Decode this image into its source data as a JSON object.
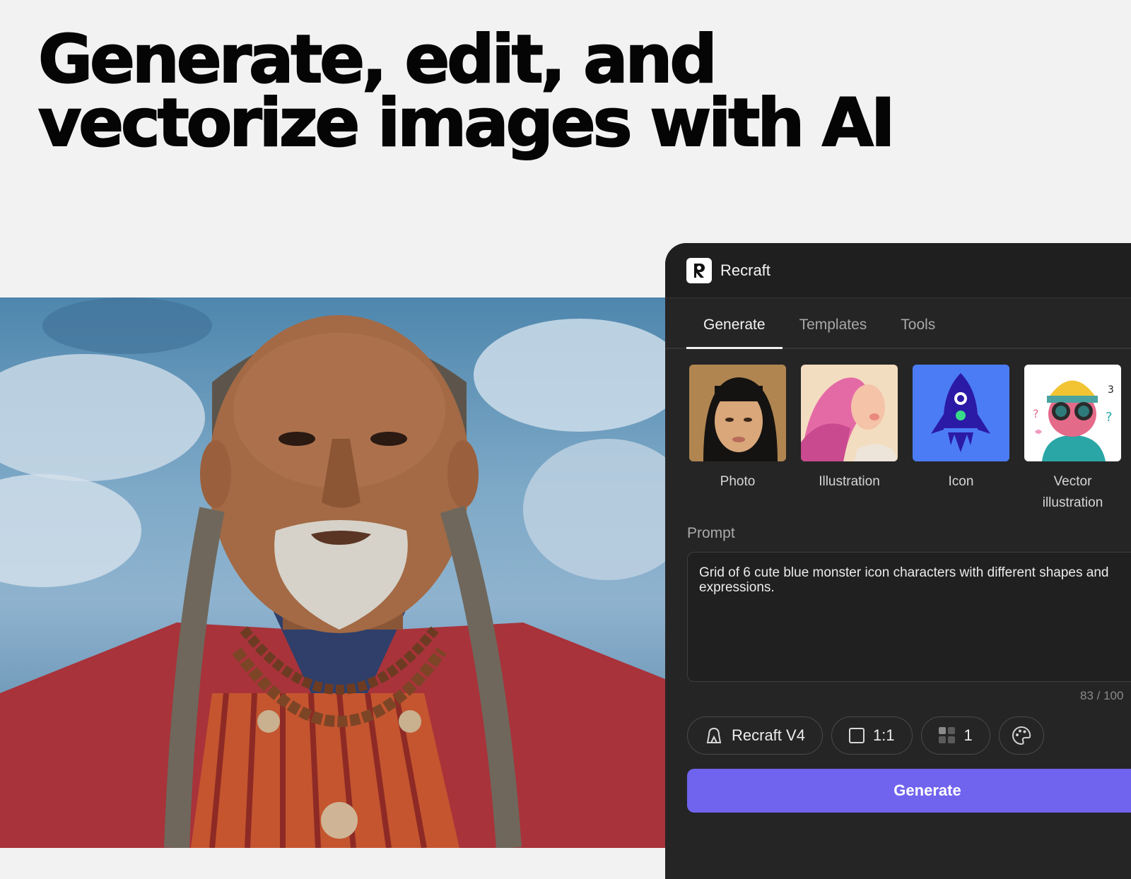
{
  "hero": {
    "line1": "Generate, edit, and",
    "line2": "vectorize images with AI"
  },
  "panel": {
    "app_title": "Recraft",
    "logo_icon": "recraft-logo-icon",
    "tabs": [
      {
        "label": "Generate",
        "active": true
      },
      {
        "label": "Templates",
        "active": false
      },
      {
        "label": "Tools",
        "active": false
      }
    ],
    "styles": [
      {
        "label": "Photo"
      },
      {
        "label": "Illustration"
      },
      {
        "label": "Icon"
      },
      {
        "label": "Vector illustration"
      }
    ],
    "prompt": {
      "label": "Prompt",
      "value": "Grid of 6 cute blue monster icon characters with different shapes and expressions.",
      "counter": "83 / 100"
    },
    "controls": {
      "model": "Recraft V4",
      "aspect_ratio": "1:1",
      "count": "1",
      "palette_icon": "palette-icon"
    },
    "generate_label": "Generate",
    "colors": {
      "accent": "#7063ee",
      "panel_bg": "#252525",
      "icon_tile": "#4b7cf5"
    }
  }
}
